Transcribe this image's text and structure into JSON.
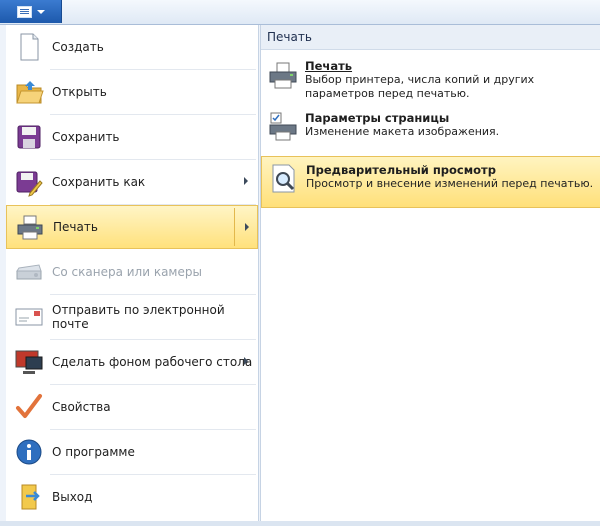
{
  "menu": {
    "items": [
      {
        "label": "Создать",
        "icon": "new-document-icon"
      },
      {
        "label": "Открыть",
        "icon": "open-folder-icon"
      },
      {
        "label": "Сохранить",
        "icon": "save-disk-icon"
      },
      {
        "label": "Сохранить как",
        "icon": "save-as-icon",
        "submenu": true
      },
      {
        "label": "Печать",
        "icon": "printer-icon",
        "submenu": true,
        "highlighted": true
      },
      {
        "label": "Со сканера или камеры",
        "icon": "scanner-icon",
        "disabled": true
      },
      {
        "label": "Отправить по электронной почте",
        "icon": "email-icon"
      },
      {
        "label": "Сделать фоном рабочего стола",
        "icon": "desktop-background-icon",
        "submenu": true
      },
      {
        "label": "Свойства",
        "icon": "checkmark-icon"
      },
      {
        "label": "О программе",
        "icon": "info-icon"
      },
      {
        "label": "Выход",
        "icon": "exit-icon"
      }
    ]
  },
  "submenu": {
    "header": "Печать",
    "items": [
      {
        "title": "Печать",
        "desc": "Выбор принтера, числа копий и других параметров перед печатью.",
        "icon": "printer-icon"
      },
      {
        "title": "Параметры страницы",
        "desc": "Изменение макета изображения.",
        "icon": "page-setup-icon"
      },
      {
        "title": "Предварительный просмотр",
        "desc": "Просмотр и внесение изменений перед печатью.",
        "icon": "print-preview-icon",
        "highlighted": true
      }
    ]
  },
  "colors": {
    "accent": "#1d59ac",
    "highlight": "#ffe17c"
  }
}
